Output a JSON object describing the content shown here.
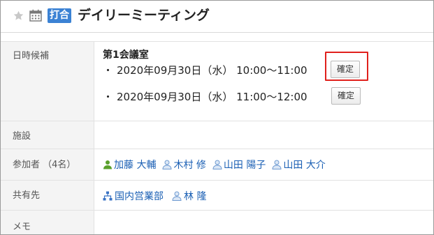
{
  "header": {
    "badge": "打合",
    "title": "デイリーミーティング"
  },
  "fields": {
    "candidates_label": "日時候補",
    "facility_label": "施設",
    "participants_label": "参加者 （4名）",
    "share_label": "共有先",
    "memo_label": "メモ"
  },
  "candidates": {
    "room": "第1会議室",
    "bullet": "・",
    "items": [
      {
        "datetime": "2020年09月30日（水） 10:00～11:00",
        "button": "確定"
      },
      {
        "datetime": "2020年09月30日（水） 11:00～12:00",
        "button": "確定"
      }
    ]
  },
  "participants": [
    {
      "name": "加藤 大輔",
      "icon": "user-icon",
      "color": "#5aa02c"
    },
    {
      "name": "木村 修",
      "icon": "user-icon",
      "color": "#6f9bd1"
    },
    {
      "name": "山田 陽子",
      "icon": "user-icon",
      "color": "#6f9bd1"
    },
    {
      "name": "山田 大介",
      "icon": "user-icon",
      "color": "#6f9bd1"
    }
  ],
  "shares": [
    {
      "name": "国内営業部",
      "icon": "organization-icon",
      "color": "#3a73c4"
    },
    {
      "name": "林 隆",
      "icon": "user-icon",
      "color": "#6f9bd1"
    }
  ],
  "colors": {
    "badge": "#3b82d4",
    "link": "#1a5fb4",
    "highlight": "#e0201c"
  }
}
